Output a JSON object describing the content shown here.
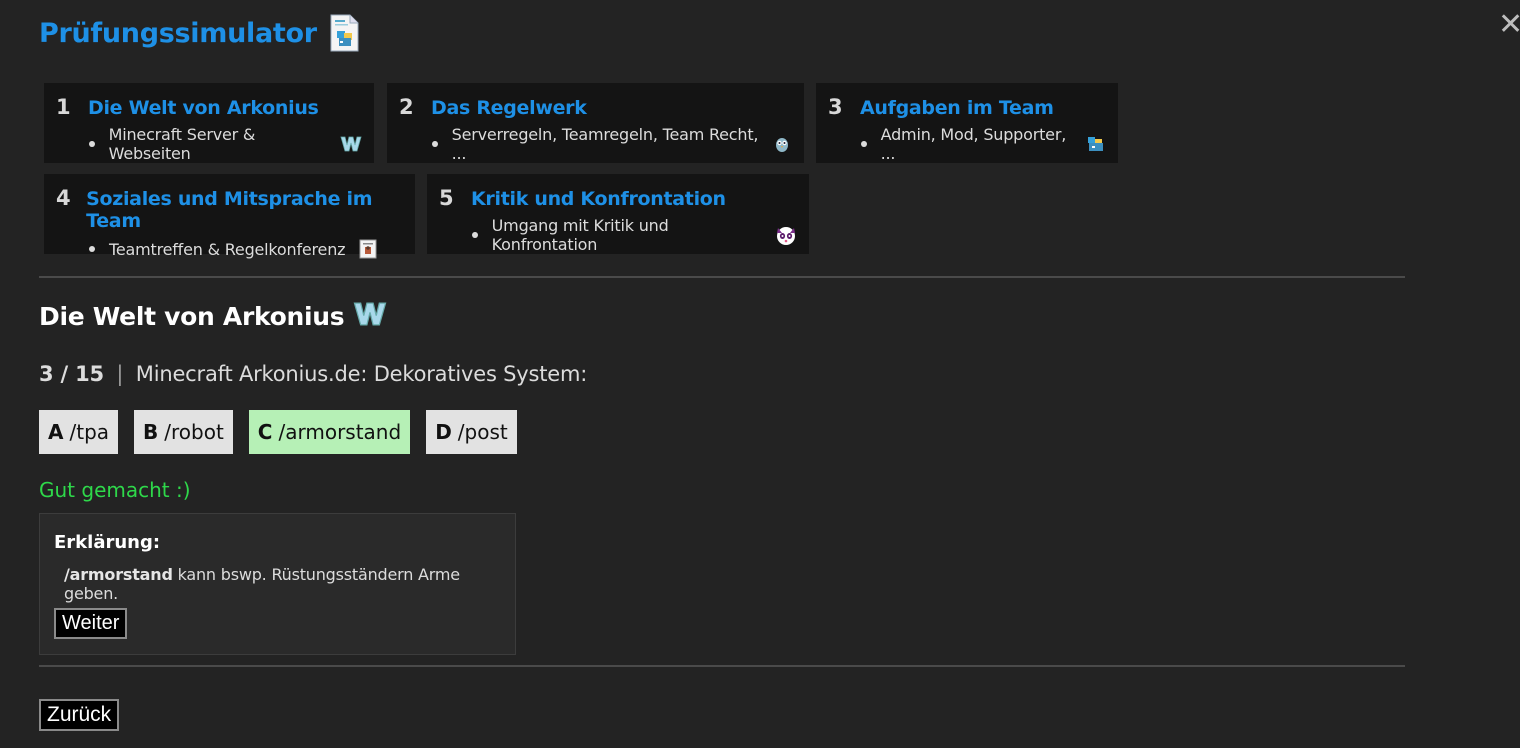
{
  "app": {
    "title": "Prüfungssimulator",
    "close_symbol": "✕"
  },
  "categories": [
    {
      "num": "1",
      "title": "Die Welt von Arkonius",
      "sub": "Minecraft Server & Webseiten",
      "icon": "w-logo-icon"
    },
    {
      "num": "2",
      "title": "Das Regelwerk",
      "sub": "Serverregeln, Teamregeln, Team Recht, ...",
      "icon": "owl-icon"
    },
    {
      "num": "3",
      "title": "Aufgaben im Team",
      "sub": "Admin, Mod, Supporter, ...",
      "icon": "team-icon"
    },
    {
      "num": "4",
      "title": "Soziales und Mitsprache im Team",
      "sub": "Teamtreffen & Regelkonferenz",
      "icon": "document-icon"
    },
    {
      "num": "5",
      "title": "Kritik und Konfrontation",
      "sub": "Umgang mit Kritik und Konfrontation",
      "icon": "panda-icon"
    }
  ],
  "section": {
    "title": "Die Welt von Arkonius"
  },
  "question": {
    "count": "3 / 15",
    "separator": "|",
    "text": "Minecraft Arkonius.de: Dekoratives System:"
  },
  "answers": [
    {
      "letter": "A",
      "text": "/tpa",
      "state": "neutral"
    },
    {
      "letter": "B",
      "text": "/robot",
      "state": "neutral"
    },
    {
      "letter": "C",
      "text": "/armorstand",
      "state": "correct"
    },
    {
      "letter": "D",
      "text": "/post",
      "state": "neutral"
    }
  ],
  "feedback": "Gut gemacht :)",
  "explanation": {
    "label": "Erklärung:",
    "command": "/armorstand",
    "text": "kann bswp. Rüstungsständern Arme geben."
  },
  "buttons": {
    "next": "Weiter",
    "back": "Zurück"
  },
  "colors": {
    "accent": "#1e90e6",
    "correct_bg": "#b6f0b6",
    "feedback": "#2ed84a",
    "background": "#232323",
    "card_bg": "#141414"
  }
}
